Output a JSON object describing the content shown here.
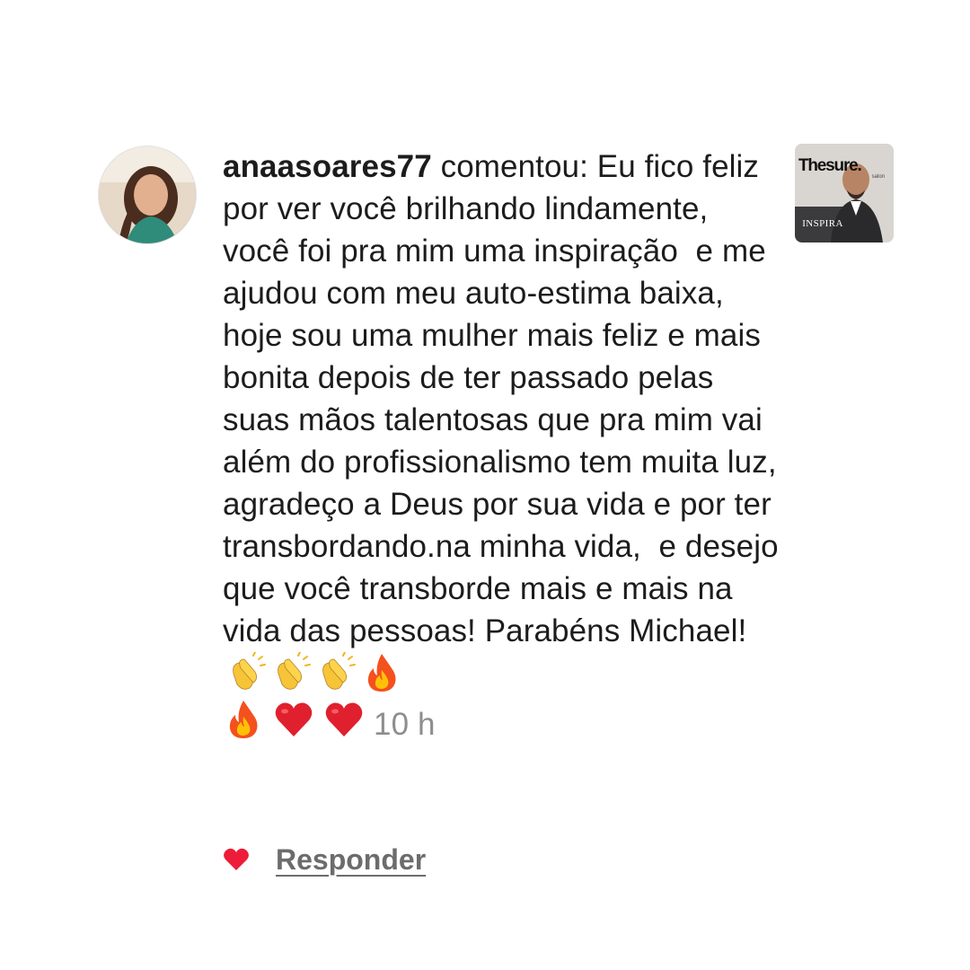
{
  "comment": {
    "username": "anaasoares77",
    "action": " comentou: ",
    "text": "Eu fico feliz por ver você brilhando lindamente, você foi pra mim uma inspiração  e me ajudou com meu auto-estima baixa, hoje sou uma mulher mais feliz e mais bonita depois de ter passado pelas suas mãos talentosas que pra mim vai além do profissionalismo tem muita luz, agradeço a Deus por sua vida e por ter transbordando.na minha vida,  e desejo que você transborde mais e mais na vida das pessoas! Parabéns Michael!",
    "emojis": [
      "clapping-hands",
      "clapping-hands",
      "clapping-hands",
      "fire",
      "fire",
      "red-heart",
      "red-heart"
    ],
    "timestamp": "10 h"
  },
  "actions": {
    "reply_label": "Responder",
    "liked": true
  },
  "post_thumbnail": {
    "brand_text": "Thesure.",
    "sub_text": "salon",
    "label": "INSPIRA"
  },
  "colors": {
    "text": "#1c1c1c",
    "muted": "#8e8e8e",
    "reply": "#6c6c6c",
    "like": "#ed1c39",
    "background": "#ffffff"
  }
}
